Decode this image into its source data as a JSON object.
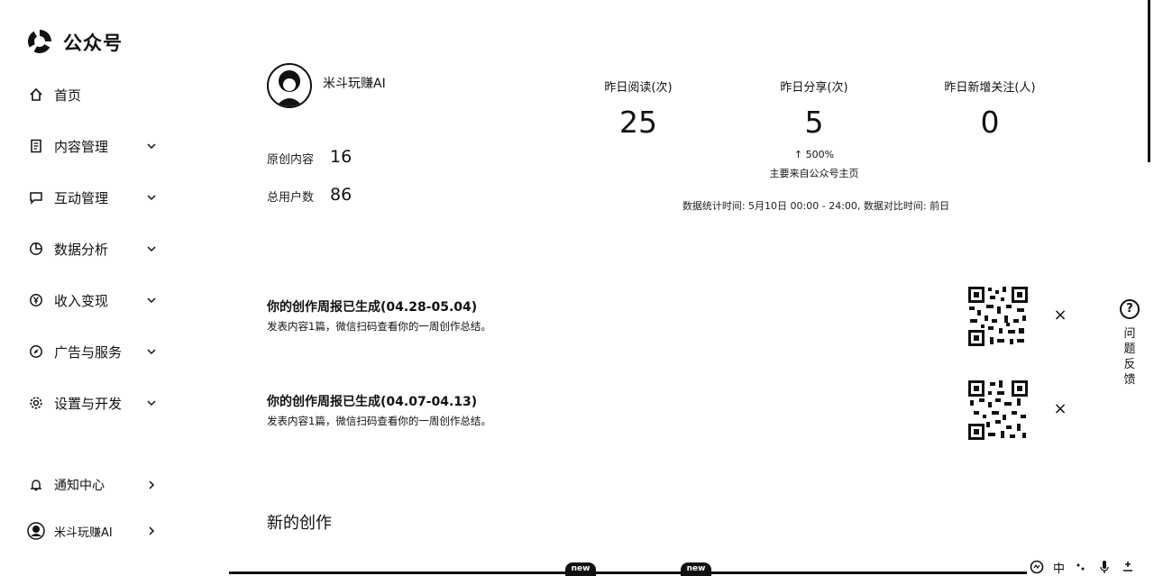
{
  "brand": {
    "name": "公众号"
  },
  "sidebar": {
    "items": [
      {
        "label": "首页",
        "icon": "home-icon",
        "has_chevron": false
      },
      {
        "label": "内容管理",
        "icon": "document-icon",
        "has_chevron": true
      },
      {
        "label": "互动管理",
        "icon": "chat-icon",
        "has_chevron": true
      },
      {
        "label": "数据分析",
        "icon": "pie-chart-icon",
        "has_chevron": true
      },
      {
        "label": "收入变现",
        "icon": "yen-icon",
        "has_chevron": true
      },
      {
        "label": "广告与服务",
        "icon": "compass-icon",
        "has_chevron": true
      },
      {
        "label": "设置与开发",
        "icon": "gear-icon",
        "has_chevron": true
      }
    ],
    "bottom": [
      {
        "label": "通知中心",
        "icon": "bell-icon"
      },
      {
        "label": "米斗玩赚AI",
        "icon": "avatar-icon"
      }
    ]
  },
  "account": {
    "name": "米斗玩赚AI",
    "original_label": "原创内容",
    "original_count": "16",
    "users_label": "总用户数",
    "users_count": "86"
  },
  "metrics": {
    "reads_label": "昨日阅读(次)",
    "reads_value": "25",
    "shares_label": "昨日分享(次)",
    "shares_value": "5",
    "follows_label": "昨日新增关注(人)",
    "follows_value": "0",
    "shares_delta": "↑ 500%",
    "shares_source": "主要来自公众号主页",
    "stats_time": "数据统计时间: 5月10日 00:00 - 24:00, 数据对比时间: 前日"
  },
  "reports": [
    {
      "title": "你的创作周报已生成(04.28-05.04)",
      "subtitle": "发表内容1篇，微信扫码查看你的一周创作总结。"
    },
    {
      "title": "你的创作周报已生成(04.07-04.13)",
      "subtitle": "发表内容1篇，微信扫码查看你的一周创作总结。"
    }
  ],
  "close_glyph": "×",
  "new_creation": {
    "title": "新的创作"
  },
  "feedback": {
    "label": "问题反馈",
    "chars": [
      "问",
      "题",
      "反",
      "馈"
    ],
    "glyph": "?"
  },
  "taskbar": {
    "new_badge": "new",
    "lang": "中"
  }
}
